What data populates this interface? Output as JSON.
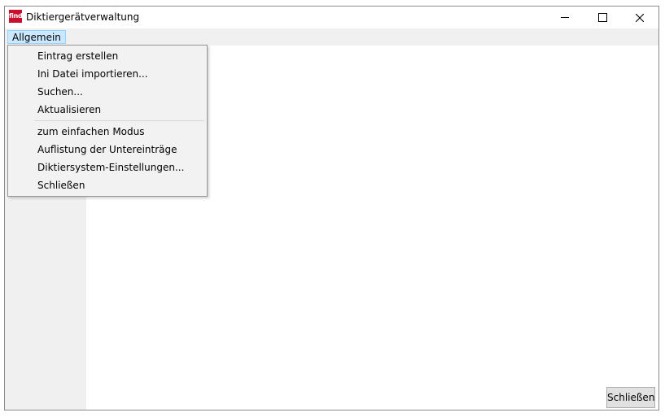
{
  "window": {
    "title": "Diktiergerätverwaltung",
    "icon_text": "find",
    "icon_color": "#c8102e"
  },
  "menubar": {
    "items": [
      {
        "label": "Allgemein",
        "active": true
      }
    ]
  },
  "dropdown": {
    "groups": [
      [
        "Eintrag erstellen",
        "Ini Datei importieren...",
        "Suchen...",
        "Aktualisieren"
      ],
      [
        "zum einfachen Modus",
        "Auflistung der Untereinträge",
        "Diktiersystem-Einstellungen...",
        "Schließen"
      ]
    ]
  },
  "footer": {
    "close_label": "Schließen"
  },
  "colors": {
    "menu_highlight": "#cce8ff",
    "menu_highlight_border": "#99d1ff",
    "panel_bg": "#f0f0f0"
  }
}
